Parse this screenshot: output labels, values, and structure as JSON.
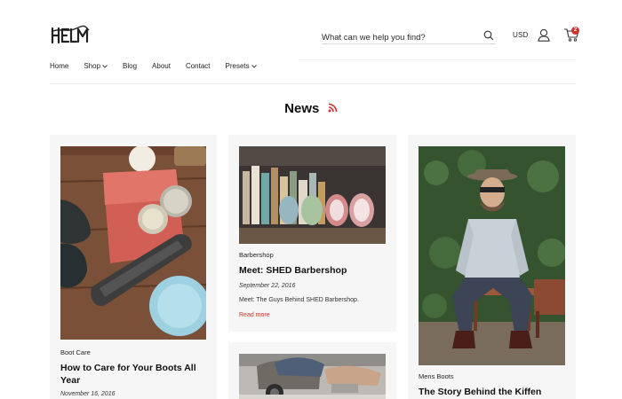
{
  "header": {
    "logo_text": "HELM",
    "search_placeholder": "What can we help you find?",
    "currency": "USD",
    "cart_count": "2"
  },
  "nav": {
    "items": [
      {
        "label": "Home",
        "has_dropdown": false
      },
      {
        "label": "Shop",
        "has_dropdown": true
      },
      {
        "label": "Blog",
        "has_dropdown": false
      },
      {
        "label": "About",
        "has_dropdown": false
      },
      {
        "label": "Contact",
        "has_dropdown": false
      },
      {
        "label": "Presets",
        "has_dropdown": true
      }
    ]
  },
  "page": {
    "title": "News"
  },
  "articles": [
    {
      "category": "Boot Care",
      "title": "How to Care for Your Boots All Year",
      "date": "November 16, 2016"
    },
    {
      "category": "Barbershop",
      "title": "Meet: SHED Barbershop",
      "date": "September 22, 2016",
      "excerpt": "Meet: The Guys Behind SHED Barbershop.",
      "read_more": "Read more"
    },
    {
      "category": "Mens Boots",
      "title": "The Story Behind the Kiffen"
    }
  ],
  "colors": {
    "accent": "#d0312d",
    "card_bg": "#f6f6f6",
    "text": "#111111"
  }
}
